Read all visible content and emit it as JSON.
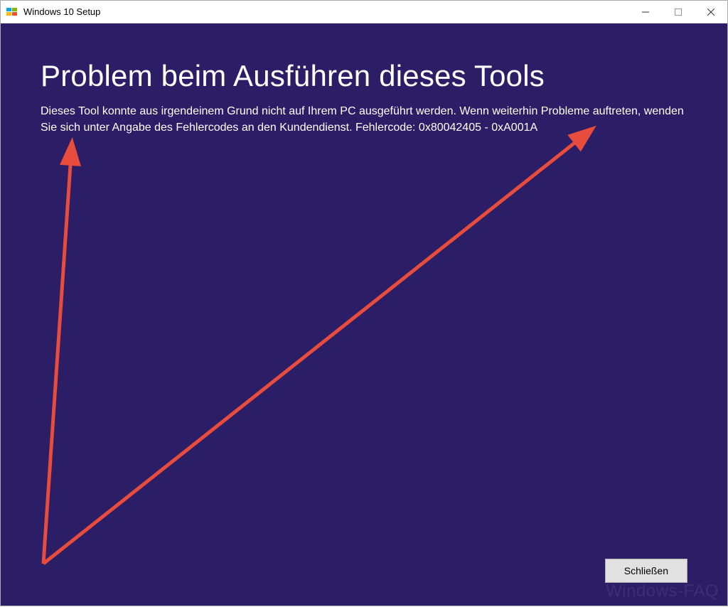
{
  "titlebar": {
    "title": "Windows 10 Setup"
  },
  "content": {
    "heading": "Problem beim Ausführen dieses Tools",
    "body": "Dieses Tool konnte aus irgendeinem Grund nicht auf Ihrem PC ausgeführt werden. Wenn weiterhin Probleme auftreten, wenden Sie sich unter Angabe des Fehlercodes an den Kundendienst. Fehlercode: 0x80042405 - 0xA001A"
  },
  "footer": {
    "close_label": "Schließen"
  },
  "watermark": "Windows-FAQ",
  "colors": {
    "background": "#2b1e66",
    "arrow": "#e74c3c"
  }
}
